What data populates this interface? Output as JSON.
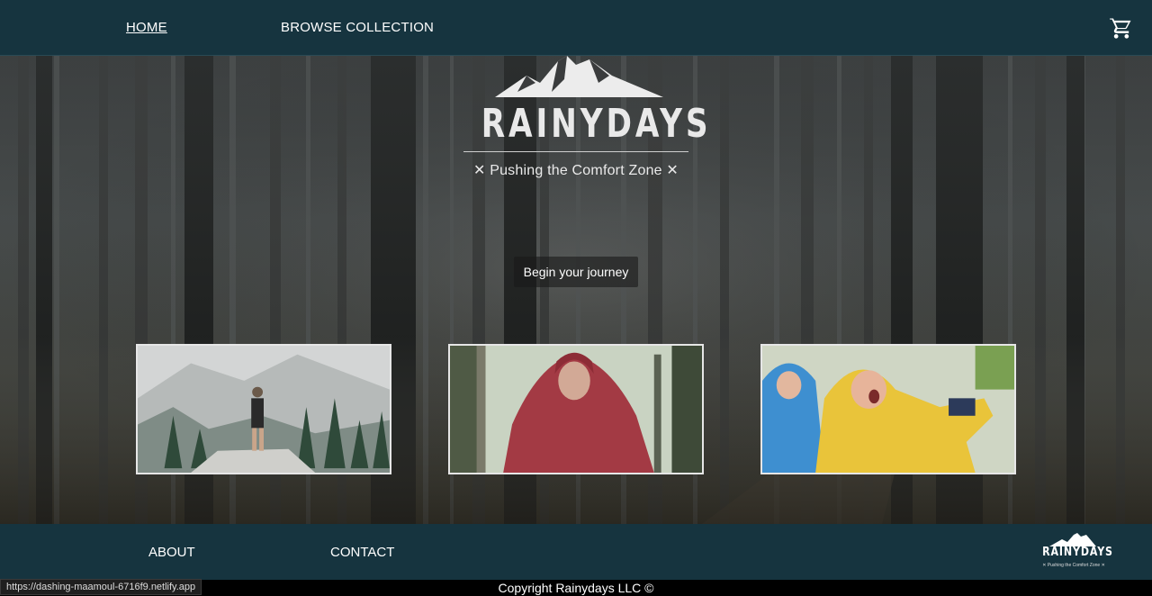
{
  "header": {
    "nav": {
      "home": "HOME",
      "browse": "BROWSE COLLECTION"
    },
    "cart_icon": "shopping-cart-icon"
  },
  "hero": {
    "brand": "RAINYDAYS",
    "tagline": "✕ Pushing the Comfort Zone ✕",
    "cta": "Begin your journey",
    "cards": [
      {
        "name": "hiker-on-rock-mountain-photo"
      },
      {
        "name": "woman-red-rain-jacket-photo"
      },
      {
        "name": "children-rain-coats-photo"
      }
    ]
  },
  "footer": {
    "about": "ABOUT",
    "contact": "CONTACT",
    "logo_brand": "RAINYDAYS",
    "logo_tagline": "✕ Pushing the Comfort Zone ✕",
    "copyright": "Copyright Rainydays LLC ©"
  },
  "status_url": "https://dashing-maamoul-6716f9.netlify.app",
  "colors": {
    "nav_bg": "#16343f",
    "text": "#ffffff"
  }
}
